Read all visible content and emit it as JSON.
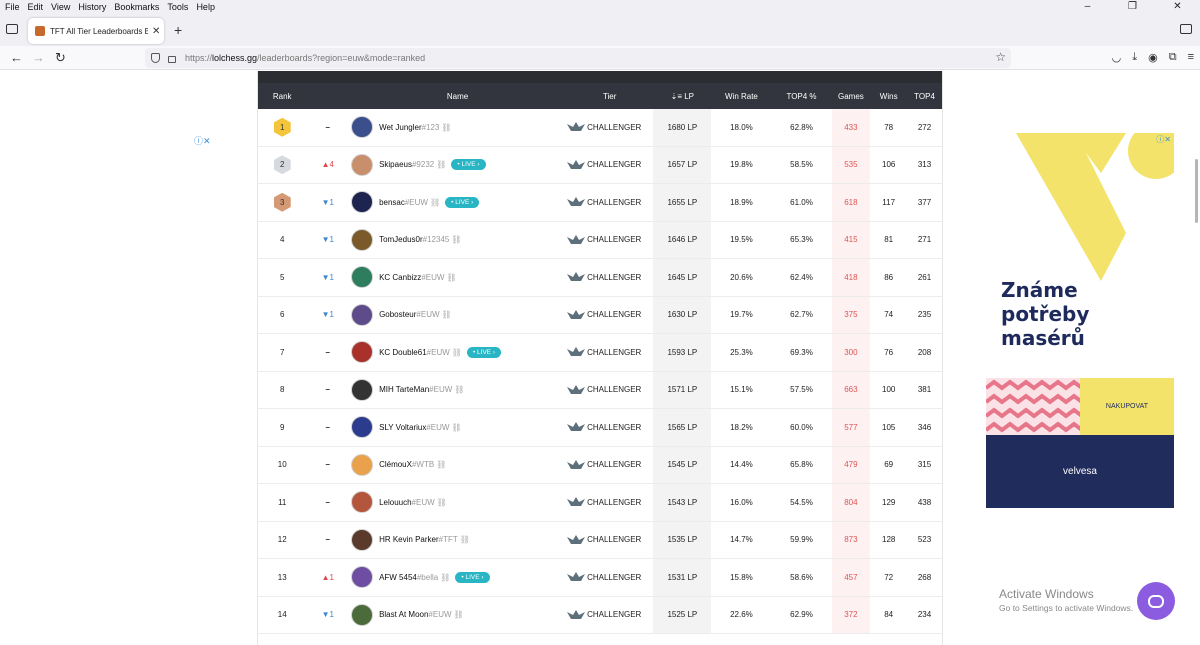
{
  "browser": {
    "menu": [
      "File",
      "Edit",
      "View",
      "History",
      "Bookmarks",
      "Tools",
      "Help"
    ],
    "tab_title": "TFT All Tier Leaderboards EUW -",
    "url_prefix": "https://",
    "url_host": "lolchess.gg",
    "url_path": "/leaderboards?region=euw&mode=ranked"
  },
  "table": {
    "headers": {
      "rank": "Rank",
      "name": "Name",
      "tier": "Tier",
      "lp": "LP",
      "win_rate": "Win Rate",
      "top4_pct": "TOP4 %",
      "games": "Games",
      "wins": "Wins",
      "top4": "TOP4"
    },
    "live_label": "LIVE",
    "rows": [
      {
        "rank": "1",
        "change": "–",
        "name": "Wet Jungler",
        "tag": "#123",
        "live": false,
        "tier": "CHALLENGER",
        "lp": "1680 LP",
        "win_rate": "18.0%",
        "top4_pct": "62.8%",
        "games": "433",
        "wins": "78",
        "top4": "272"
      },
      {
        "rank": "2",
        "change": "▲4",
        "name": "Skipaeus",
        "tag": "#9232",
        "live": true,
        "tier": "CHALLENGER",
        "lp": "1657 LP",
        "win_rate": "19.8%",
        "top4_pct": "58.5%",
        "games": "535",
        "wins": "106",
        "top4": "313"
      },
      {
        "rank": "3",
        "change": "▼1",
        "name": "bensac",
        "tag": "#EUW",
        "live": true,
        "tier": "CHALLENGER",
        "lp": "1655 LP",
        "win_rate": "18.9%",
        "top4_pct": "61.0%",
        "games": "618",
        "wins": "117",
        "top4": "377"
      },
      {
        "rank": "4",
        "change": "▼1",
        "name": "TomJedus0r",
        "tag": "#12345",
        "live": false,
        "tier": "CHALLENGER",
        "lp": "1646 LP",
        "win_rate": "19.5%",
        "top4_pct": "65.3%",
        "games": "415",
        "wins": "81",
        "top4": "271"
      },
      {
        "rank": "5",
        "change": "▼1",
        "name": "KC Canbizz",
        "tag": "#EUW",
        "live": false,
        "tier": "CHALLENGER",
        "lp": "1645 LP",
        "win_rate": "20.6%",
        "top4_pct": "62.4%",
        "games": "418",
        "wins": "86",
        "top4": "261"
      },
      {
        "rank": "6",
        "change": "▼1",
        "name": "Gobosteur",
        "tag": "#EUW",
        "live": false,
        "tier": "CHALLENGER",
        "lp": "1630 LP",
        "win_rate": "19.7%",
        "top4_pct": "62.7%",
        "games": "375",
        "wins": "74",
        "top4": "235"
      },
      {
        "rank": "7",
        "change": "–",
        "name": "KC Double61",
        "tag": "#EUW",
        "live": true,
        "tier": "CHALLENGER",
        "lp": "1593 LP",
        "win_rate": "25.3%",
        "top4_pct": "69.3%",
        "games": "300",
        "wins": "76",
        "top4": "208"
      },
      {
        "rank": "8",
        "change": "–",
        "name": "MIH TarteMan",
        "tag": "#EUW",
        "live": false,
        "tier": "CHALLENGER",
        "lp": "1571 LP",
        "win_rate": "15.1%",
        "top4_pct": "57.5%",
        "games": "663",
        "wins": "100",
        "top4": "381"
      },
      {
        "rank": "9",
        "change": "–",
        "name": "SLY Voltariux",
        "tag": "#EUW",
        "live": false,
        "tier": "CHALLENGER",
        "lp": "1565 LP",
        "win_rate": "18.2%",
        "top4_pct": "60.0%",
        "games": "577",
        "wins": "105",
        "top4": "346"
      },
      {
        "rank": "10",
        "change": "–",
        "name": "ClémouX",
        "tag": "#WTB",
        "live": false,
        "tier": "CHALLENGER",
        "lp": "1545 LP",
        "win_rate": "14.4%",
        "top4_pct": "65.8%",
        "games": "479",
        "wins": "69",
        "top4": "315"
      },
      {
        "rank": "11",
        "change": "–",
        "name": "Lelouuch",
        "tag": "#EUW",
        "live": false,
        "tier": "CHALLENGER",
        "lp": "1543 LP",
        "win_rate": "16.0%",
        "top4_pct": "54.5%",
        "games": "804",
        "wins": "129",
        "top4": "438"
      },
      {
        "rank": "12",
        "change": "–",
        "name": "HR Kevin Parker",
        "tag": "#TFT",
        "live": false,
        "tier": "CHALLENGER",
        "lp": "1535 LP",
        "win_rate": "14.7%",
        "top4_pct": "59.9%",
        "games": "873",
        "wins": "128",
        "top4": "523"
      },
      {
        "rank": "13",
        "change": "▲1",
        "name": "AFW 5454",
        "tag": "#bella",
        "live": true,
        "tier": "CHALLENGER",
        "lp": "1531 LP",
        "win_rate": "15.8%",
        "top4_pct": "58.6%",
        "games": "457",
        "wins": "72",
        "top4": "268"
      },
      {
        "rank": "14",
        "change": "▼1",
        "name": "Blast At Moon",
        "tag": "#EUW",
        "live": false,
        "tier": "CHALLENGER",
        "lp": "1525 LP",
        "win_rate": "22.6%",
        "top4_pct": "62.9%",
        "games": "372",
        "wins": "84",
        "top4": "234"
      }
    ]
  },
  "ad": {
    "heading": "Známe potřeby masérů",
    "cta": "NAKUPOVAT",
    "brand": "velvesa"
  },
  "watermark": {
    "line1": "Activate Windows",
    "line2": "Go to Settings to activate Windows."
  }
}
